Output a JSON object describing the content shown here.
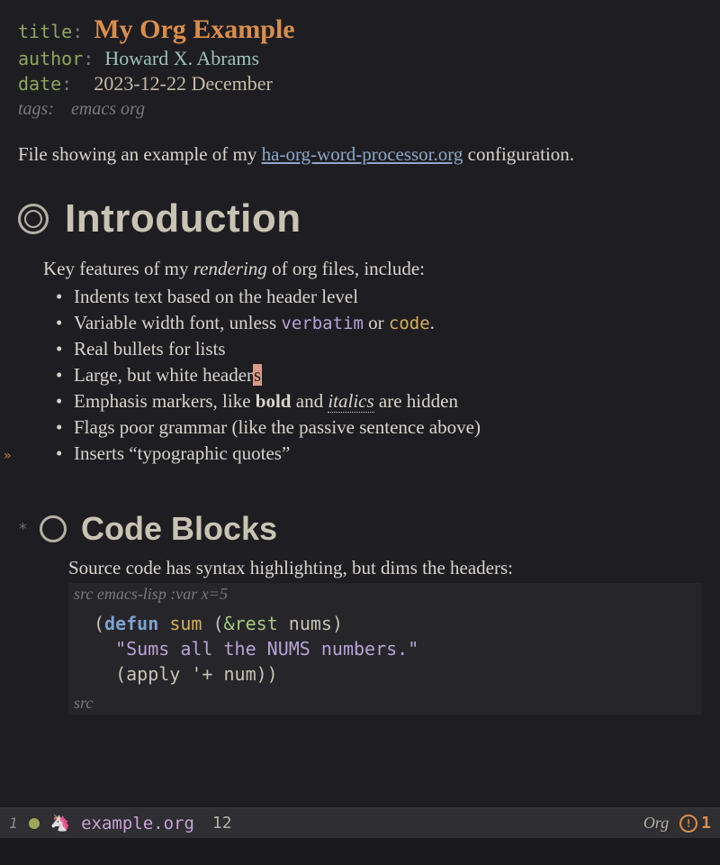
{
  "meta": {
    "title_key": "title",
    "title_val": "My Org Example",
    "author_key": "author",
    "author_val": "Howard X. Abrams",
    "date_key": "date",
    "date_val": "2023-12-22 December",
    "tags_key": "tags:",
    "tags_val": "emacs org"
  },
  "intro_para": {
    "before": "File showing an example of my ",
    "link": "ha-org-word-processor.org",
    "after": " configuration."
  },
  "h1": "Introduction",
  "lead": {
    "before": "Key features of my ",
    "em": "rendering",
    "after": " of org files, include:"
  },
  "features": {
    "f0": "Indents text based on the header level",
    "f1_a": "Variable width font, unless ",
    "f1_verb": "verbatim",
    "f1_mid": " or ",
    "f1_code": "code",
    "f1_end": ".",
    "f2": "Real bullets for lists",
    "f3_a": "Large, but white header",
    "f3_cursor": "s",
    "f4_a": "Emphasis markers, like ",
    "f4_bold": "bold",
    "f4_mid": " and ",
    "f4_ital": "italics",
    "f4_end": " are hidden",
    "f5": "Flags poor grammar (like the passive sentence above)",
    "f6": "Inserts “typographic quotes”"
  },
  "h2_star": "*",
  "h2": "Code Blocks",
  "src_intro": "Source code has syntax highlighting, but dims the headers:",
  "src_header": "src emacs-lisp :var x=5",
  "code": {
    "l1_open": "(",
    "l1_defun": "defun",
    "l1_sp": " ",
    "l1_fn": "sum",
    "l1_args_open": " (",
    "l1_amp": "&rest",
    "l1_nums": " nums",
    "l1_args_close": ")",
    "l2_str": "  \"Sums all the NUMS numbers.\"",
    "l3": "  (apply '+ num))"
  },
  "src_footer": "src",
  "gutter": "»",
  "modeline": {
    "workspace": "1",
    "file": "example.org",
    "line": "12",
    "mode": "Org",
    "warn": "1"
  }
}
